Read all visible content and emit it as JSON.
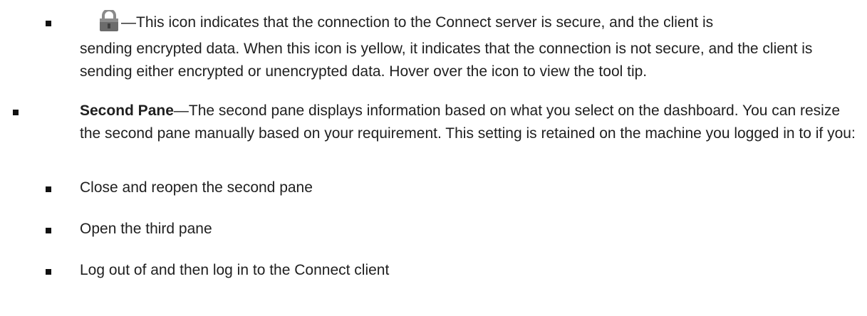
{
  "items": [
    {
      "icon": "lock-icon",
      "first_line": "—This icon indicates that the connection to the Connect server is secure, and the client is",
      "rest": "sending encrypted data. When this icon is yellow, it indicates that the connection is not secure, and the client is sending either encrypted or unencrypted data. Hover over the icon to view the tool tip."
    },
    {
      "term": "Second Pane",
      "text": "—The second pane displays information based on what you select on the dashboard. You can resize the second pane manually based on your requirement. This setting is retained on the machine you logged in to if you:"
    }
  ],
  "sub_items": [
    "Close and reopen the second pane",
    "Open the third pane",
    "Log out of and then log in to the Connect client"
  ],
  "colors": {
    "text": "#1f1f1f",
    "lock_body": "#6b6b6b",
    "lock_shackle": "#8a8a8a"
  }
}
